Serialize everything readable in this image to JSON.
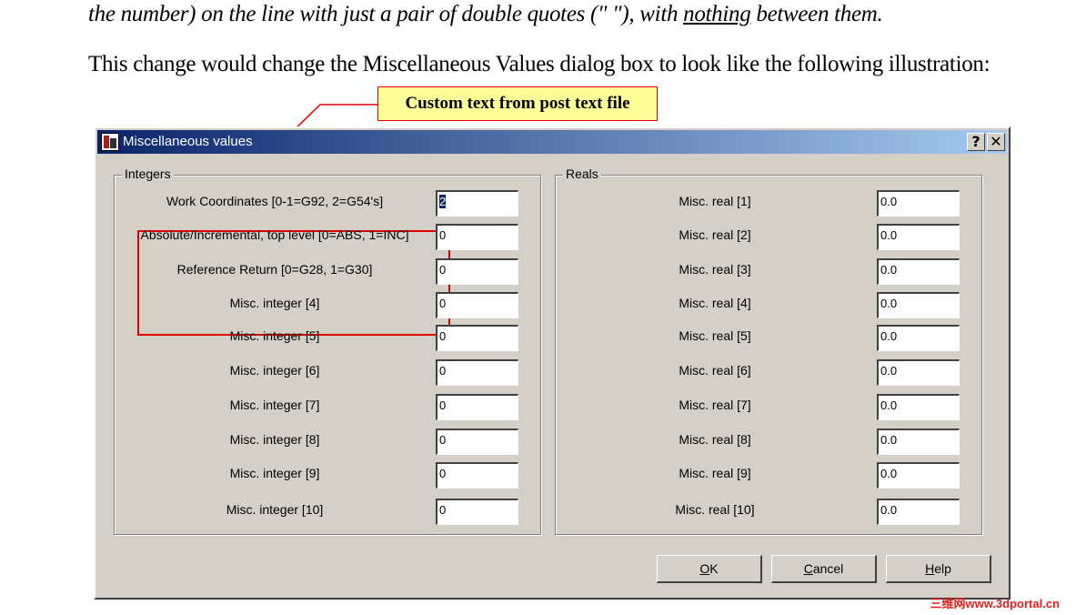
{
  "document": {
    "line1_pre": "the number) on the line with just a pair of double quotes (\" \"), with ",
    "line1_underlined": "nothing",
    "line1_post": " between them.",
    "line2": "This change would change the Miscellaneous Values dialog box to look like the following illustration:"
  },
  "callout": {
    "text": "Custom text from post text file"
  },
  "dialog": {
    "title": "Miscellaneous values",
    "help_btn": "?",
    "close_btn": "✕",
    "integers": {
      "group_label": "Integers",
      "rows": [
        {
          "label": "Work Coordinates [0-1=G92, 2=G54's]",
          "value": "2"
        },
        {
          "label": "Absolute/Incremental, top level [0=ABS, 1=INC]",
          "value": "0"
        },
        {
          "label": "Reference Return [0=G28, 1=G30]",
          "value": "0"
        },
        {
          "label": "Misc. integer [4]",
          "value": "0"
        },
        {
          "label": "Misc. integer [5]",
          "value": "0"
        },
        {
          "label": "Misc. integer [6]",
          "value": "0"
        },
        {
          "label": "Misc. integer [7]",
          "value": "0"
        },
        {
          "label": "Misc. integer [8]",
          "value": "0"
        },
        {
          "label": "Misc. integer [9]",
          "value": "0"
        },
        {
          "label": "Misc. integer [10]",
          "value": "0"
        }
      ]
    },
    "reals": {
      "group_label": "Reals",
      "rows": [
        {
          "label": "Misc. real [1]",
          "value": "0.0"
        },
        {
          "label": "Misc. real [2]",
          "value": "0.0"
        },
        {
          "label": "Misc. real [3]",
          "value": "0.0"
        },
        {
          "label": "Misc. real [4]",
          "value": "0.0"
        },
        {
          "label": "Misc. real [5]",
          "value": "0.0"
        },
        {
          "label": "Misc. real [6]",
          "value": "0.0"
        },
        {
          "label": "Misc. real [7]",
          "value": "0.0"
        },
        {
          "label": "Misc. real [8]",
          "value": "0.0"
        },
        {
          "label": "Misc. real [9]",
          "value": "0.0"
        },
        {
          "label": "Misc. real [10]",
          "value": "0.0"
        }
      ]
    },
    "buttons": {
      "ok": {
        "accel": "O",
        "rest": "K"
      },
      "cancel": {
        "accel": "C",
        "rest": "ancel"
      },
      "help": {
        "accel": "H",
        "rest": "elp"
      }
    }
  },
  "watermark": "三维网www.3dportal.cn",
  "colors": {
    "titlebar_start": "#0a246a",
    "titlebar_end": "#a6caf0",
    "callout_bg": "#ffff99",
    "highlight_red": "#e00000",
    "dialog_bg": "#d4d0c8"
  }
}
